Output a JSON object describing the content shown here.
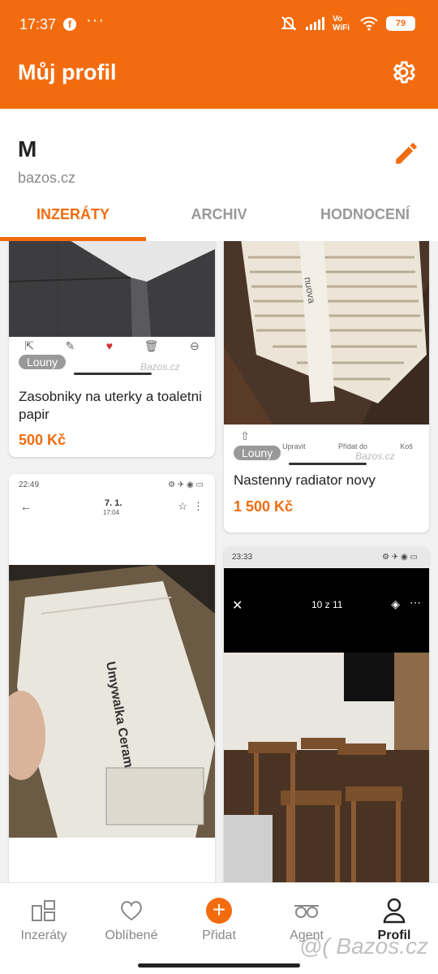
{
  "status_bar": {
    "time": "17:37",
    "dots": "···",
    "network": "Vo WiFi",
    "battery": "79"
  },
  "header": {
    "title": "Můj profil",
    "settings_icon": "gear-icon"
  },
  "profile": {
    "name": "M",
    "site": "bazos.cz",
    "edit_icon": "pencil-icon"
  },
  "tabs": [
    {
      "label": "INZERÁTY",
      "active": true
    },
    {
      "label": "ARCHIV",
      "active": false
    },
    {
      "label": "HODNOCENÍ",
      "active": false
    }
  ],
  "listings": [
    {
      "title": "Zasobniky na uterky a toaletni papir",
      "price": "500 Kč",
      "location": "Louny"
    },
    {
      "title": "Nastenny radiator novy",
      "price": "1 500 Kč",
      "location": "Louny"
    }
  ],
  "card_toolbar_right": {
    "upravit": "Upravit",
    "pridat": "Přidat do",
    "kos": "Koš"
  },
  "screenshot_texts": {
    "left_time": "22:49",
    "left_date": "7. 1.",
    "left_hour": "17:04",
    "right_time": "23:33",
    "right_counter": "10 z 11",
    "box_text": "Umywalka Ceramiczna",
    "watermark_small": "Bazos.cz"
  },
  "bottom_nav": [
    {
      "label": "Inzeráty",
      "icon": "grid-icon"
    },
    {
      "label": "Oblíbené",
      "icon": "heart-icon"
    },
    {
      "label": "Přidat",
      "icon": "plus-icon"
    },
    {
      "label": "Agent",
      "icon": "glasses-icon"
    },
    {
      "label": "Profil",
      "icon": "person-icon"
    }
  ],
  "watermark": "@( Bazos.cz",
  "colors": {
    "accent": "#f26c0f"
  }
}
